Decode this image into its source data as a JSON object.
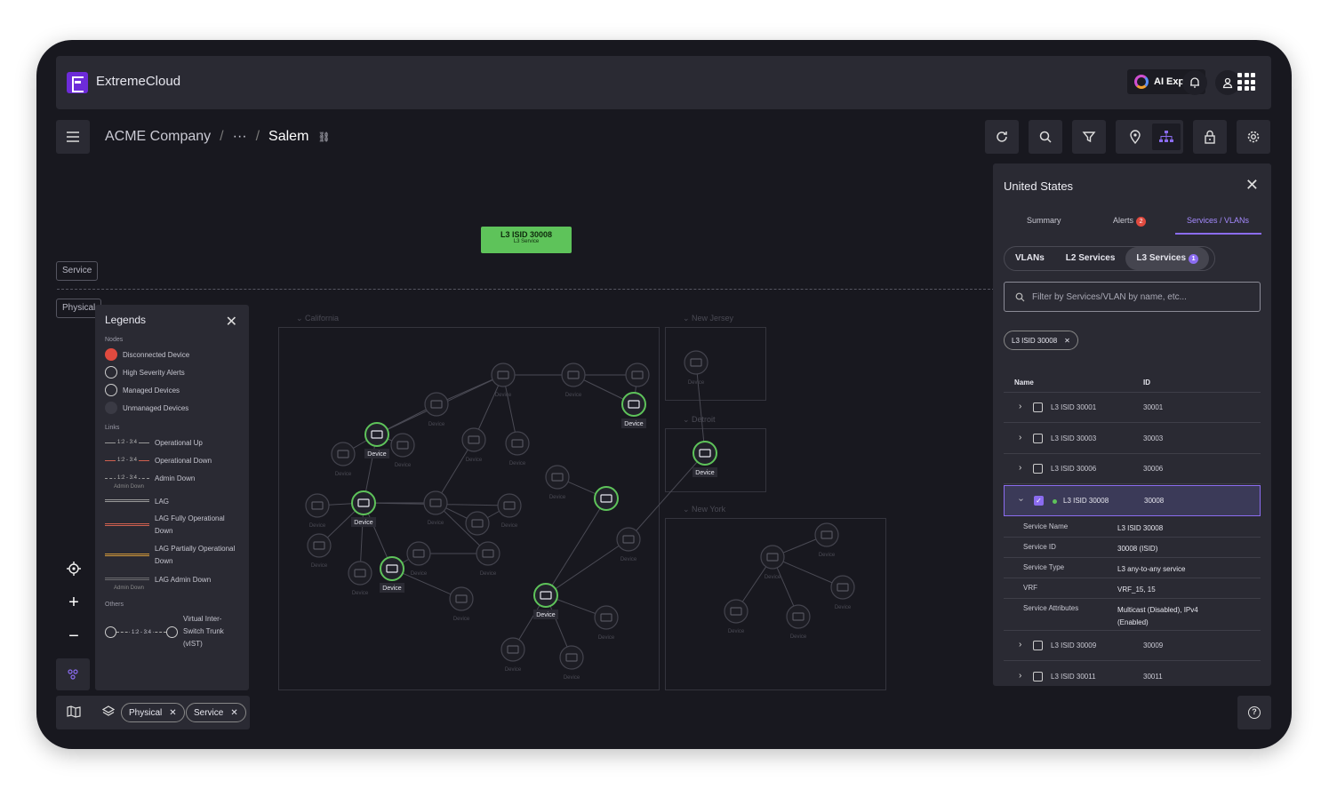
{
  "app": {
    "brand": "ExtremeCloud",
    "ai_button": "AI Expert"
  },
  "breadcrumb": {
    "root": "ACME Company",
    "ellipsis": "···",
    "current": "Salem"
  },
  "canvas": {
    "service_label": "Service",
    "physical_label": "Physical",
    "service_box": {
      "title": "L3 ISID 30008",
      "subtitle": "L3 Service",
      "color": "#5ec35a"
    },
    "regions": {
      "california": "California",
      "new_jersey": "New Jersey",
      "detroit": "Detroit",
      "new_york": "New York"
    },
    "device_label": "Device"
  },
  "legend": {
    "title": "Legends",
    "nodes_heading": "Nodes",
    "nodes": [
      "Disconnected Device",
      "High Severity Alerts",
      "Managed Devices",
      "Unmanaged Devices"
    ],
    "links_heading": "Links",
    "link_tag": "1:2 - 3:4",
    "links": [
      "Operational Up",
      "Operational Down",
      "Admin Down",
      "LAG",
      "LAG Fully Operational Down",
      "LAG Partially Operational Down",
      "LAG Admin Down"
    ],
    "admin_down_sub": "Admin Down",
    "others_heading": "Others",
    "others": [
      "Virtual Inter-Switch Trunk (vIST)"
    ]
  },
  "bottom_chips": [
    "Physical",
    "Service"
  ],
  "panel": {
    "title": "United States",
    "tabs": [
      "Summary",
      "Alerts",
      "Services / VLANs"
    ],
    "alerts_count": "2",
    "segments": [
      "VLANs",
      "L2 Services",
      "L3 Services"
    ],
    "l3_count": "1",
    "filter_placeholder": "Filter by Services/VLAN by name, etc...",
    "filter_chip": "L3 ISID 30008",
    "columns": [
      "Name",
      "ID"
    ],
    "rows": [
      {
        "name": "L3 ISID 30001",
        "id": "30001"
      },
      {
        "name": "L3 ISID 30003",
        "id": "30003"
      },
      {
        "name": "L3 ISID 30006",
        "id": "30006"
      },
      {
        "name": "L3 ISID 30008",
        "id": "30008"
      },
      {
        "name": "L3 ISID 30009",
        "id": "30009"
      },
      {
        "name": "L3 ISID 30011",
        "id": "30011"
      }
    ],
    "details": [
      {
        "k": "Service Name",
        "v": "L3 ISID 30008"
      },
      {
        "k": "Service ID",
        "v": "30008 (ISID)"
      },
      {
        "k": "Service Type",
        "v": "L3 any-to-any service"
      },
      {
        "k": "VRF",
        "v": "VRF_15, 15"
      },
      {
        "k": "Service Attributes",
        "v": "Multicast (Disabled), IPv4 (Enabled)"
      }
    ]
  },
  "colors": {
    "accent": "#8b6cf0",
    "managed": "#5ec35a",
    "alert": "#e04a3f"
  }
}
